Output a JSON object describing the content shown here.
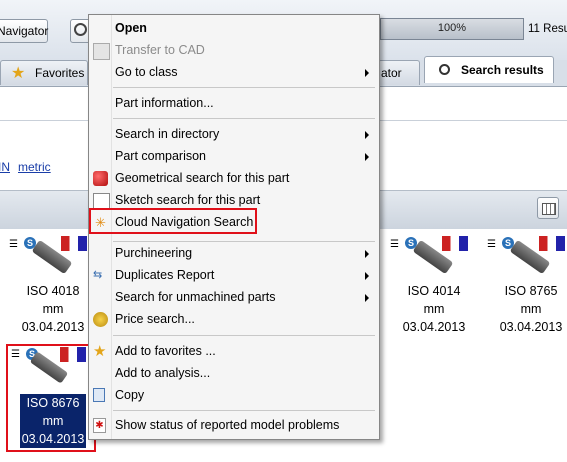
{
  "toolbar": {
    "navigator_label": "Navigator",
    "progress_text": "100%",
    "progress_value": 1.0,
    "results_text": "11 Resu"
  },
  "tabs": {
    "favorites": "Favorites",
    "navigator_partial": "ator",
    "search_results": "Search results"
  },
  "filter_links": {
    "link1": "IN",
    "link2": "metric"
  },
  "cards": [
    {
      "name": "ISO 4018",
      "unit": "mm",
      "date": "03.04.2013"
    },
    {
      "name": "ISO 4014",
      "unit": "mm",
      "date": "03.04.2013"
    },
    {
      "name": "ISO 8765",
      "unit": "mm",
      "date": "03.04.2013"
    },
    {
      "name": "ISO 8676",
      "unit": "mm",
      "date": "03.04.2013",
      "selected": true
    }
  ],
  "menu": {
    "open": "Open",
    "transfer_to_cad": "Transfer to CAD",
    "go_to_class": "Go to class",
    "part_information": "Part information...",
    "search_in_directory": "Search in directory",
    "part_comparison": "Part comparison",
    "geometrical_search": "Geometrical search for this part",
    "sketch_search": "Sketch search for this part",
    "cloud_navigation_search": "Cloud Navigation Search",
    "purchineering": "Purchineering",
    "duplicates_report": "Duplicates Report",
    "search_unmachined": "Search for unmachined parts",
    "price_search": "Price search...",
    "add_to_favorites": "Add to favorites ...",
    "add_to_analysis": "Add to analysis...",
    "copy": "Copy",
    "show_status": "Show status of reported model problems"
  },
  "colors": {
    "highlight_box": "#e0101a",
    "selection": "#0a246a",
    "link": "#1a3ea8"
  }
}
